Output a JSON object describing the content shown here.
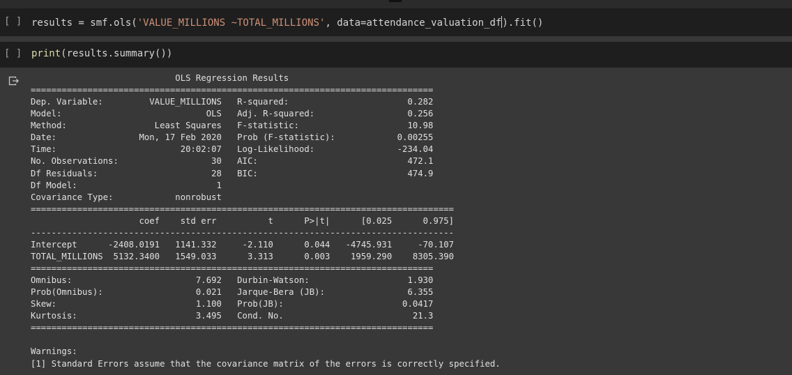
{
  "cells": [
    {
      "run_label": "[ ]",
      "code_parts": [
        "results = smf.ols(",
        "'VALUE_MILLIONS ~TOTAL_MILLIONS'",
        ", data=attendance_valuation_df",
        ").fit()"
      ]
    },
    {
      "run_label": "[ ]",
      "code_parts": [
        "print",
        "(results.summary())"
      ]
    }
  ],
  "output_icon": "output-redirect-icon",
  "colors": {
    "background": "#383838",
    "code_cell": "#1e1e1e",
    "string": "#ce9178",
    "function": "#dcdcaa",
    "text": "#e0e0e0"
  },
  "output": {
    "lines": [
      "                            OLS Regression Results                            ",
      "==============================================================================",
      "Dep. Variable:         VALUE_MILLIONS   R-squared:                       0.282",
      "Model:                            OLS   Adj. R-squared:                  0.256",
      "Method:                 Least Squares   F-statistic:                     10.98",
      "Date:                Mon, 17 Feb 2020   Prob (F-statistic):            0.00255",
      "Time:                        20:02:07   Log-Likelihood:                -234.04",
      "No. Observations:                  30   AIC:                             472.1",
      "Df Residuals:                      28   BIC:                             474.9",
      "Df Model:                           1                                         ",
      "Covariance Type:            nonrobust                                         ",
      "==================================================================================",
      "                     coef    std err          t      P>|t|      [0.025      0.975]",
      "----------------------------------------------------------------------------------",
      "Intercept      -2408.0191   1141.332     -2.110      0.044   -4745.931     -70.107",
      "TOTAL_MILLIONS  5132.3400   1549.033      3.313      0.003    1959.290    8305.390",
      "==============================================================================",
      "Omnibus:                        7.692   Durbin-Watson:                   1.930",
      "Prob(Omnibus):                  0.021   Jarque-Bera (JB):                6.355",
      "Skew:                           1.100   Prob(JB):                       0.0417",
      "Kurtosis:                       3.495   Cond. No.                         21.3",
      "==============================================================================",
      "",
      "Warnings:",
      "[1] Standard Errors assume that the covariance matrix of the errors is correctly specified."
    ]
  }
}
